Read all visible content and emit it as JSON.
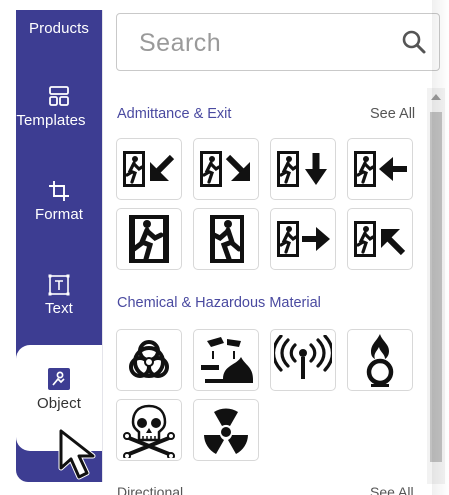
{
  "sidebar": {
    "items": [
      {
        "label": "Products",
        "icon": "products-icon"
      },
      {
        "label": "Templates",
        "icon": "templates-icon"
      },
      {
        "label": "Format",
        "icon": "crop-icon"
      },
      {
        "label": "Text",
        "icon": "text-box-icon"
      },
      {
        "label": "Object",
        "icon": "object-icon",
        "active": true
      }
    ],
    "color": "#3d3d92"
  },
  "search": {
    "placeholder": "Search"
  },
  "sections": [
    {
      "title": "Admittance & Exit",
      "see_all": "See All",
      "tiles": [
        "exit-down-left-sign",
        "exit-down-right-sign",
        "exit-down-sign",
        "exit-left-sign",
        "exit-running-man-door-left-sign",
        "exit-running-man-door-right-sign",
        "exit-right-sign",
        "exit-up-left-sign"
      ]
    },
    {
      "title": "Chemical & Hazardous Material",
      "tiles": [
        "biohazard-sign",
        "corrosive-sign",
        "non-ionizing-radiation-sign",
        "oxidizer-sign",
        "skull-crossbones-sign",
        "radiation-sign"
      ]
    },
    {
      "title": "Directional",
      "see_all": "See All"
    }
  ]
}
